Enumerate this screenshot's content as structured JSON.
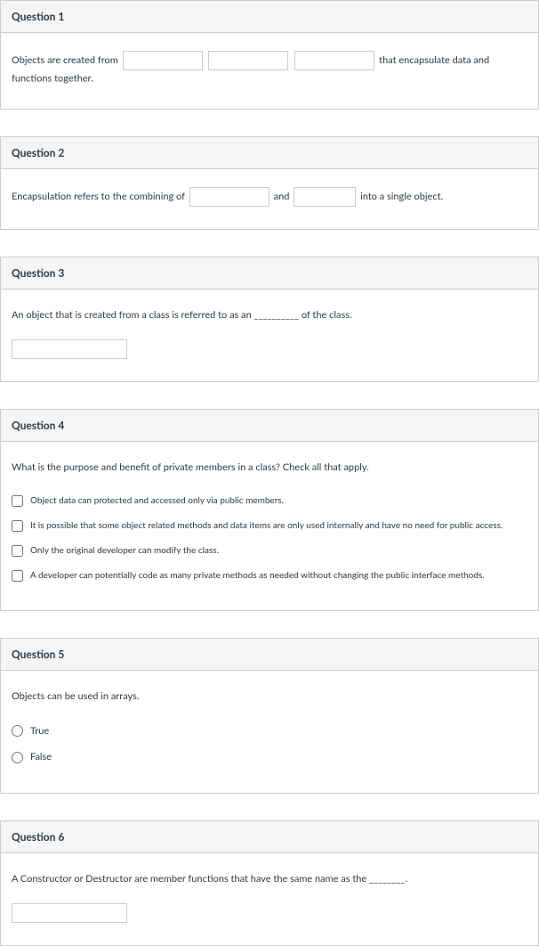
{
  "questions": [
    {
      "title": "Question 1",
      "text_before": "Objects are created from",
      "text_after": "that encapsulate data and functions together."
    },
    {
      "title": "Question 2",
      "text_before": "Encapsulation refers to the combining of",
      "text_mid": "and",
      "text_after": "into a single object."
    },
    {
      "title": "Question 3",
      "prompt": "An object that is created from a class is referred to as an __________ of the class."
    },
    {
      "title": "Question 4",
      "prompt": "What is the purpose and benefit of private members in a class? Check all that apply.",
      "options": [
        "Object data can protected and accessed only via public members.",
        "It is possible that some object related methods and data items are only used internally and have no need for public access.",
        "Only the original developer can modify the class.",
        "A developer can potentially code as many private methods as needed without changing the public interface methods."
      ]
    },
    {
      "title": "Question 5",
      "prompt": "Objects can be used in arrays.",
      "options": [
        "True",
        "False"
      ]
    },
    {
      "title": "Question 6",
      "prompt": "A Constructor or Destructor are member functions that have the same name as the ________."
    }
  ]
}
